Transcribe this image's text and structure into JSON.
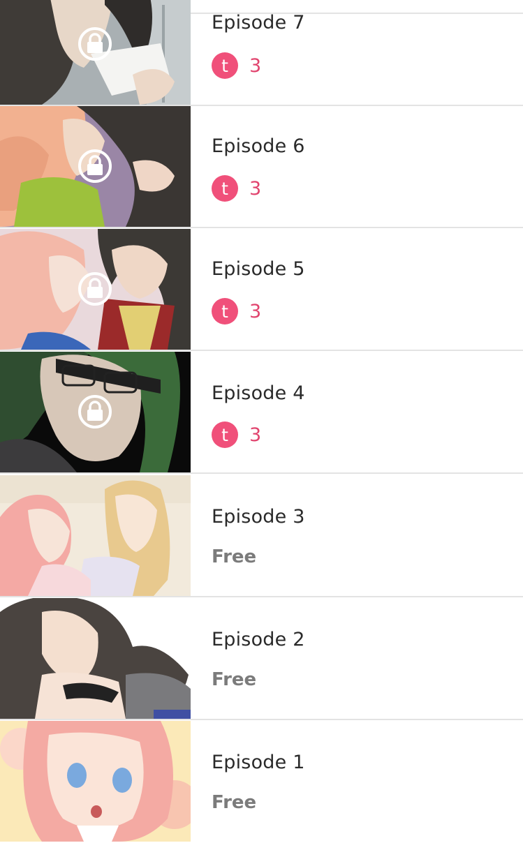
{
  "theme": {
    "coin_color": "#f0507a",
    "price_color": "#e1446e",
    "free_color": "#7b7b7b",
    "divider": "#e3e3e3"
  },
  "episodes": [
    {
      "title": "Episode 7",
      "locked": true,
      "coin_icon": "t",
      "cost": "3"
    },
    {
      "title": "Episode 6",
      "locked": true,
      "coin_icon": "t",
      "cost": "3"
    },
    {
      "title": "Episode 5",
      "locked": true,
      "coin_icon": "t",
      "cost": "3"
    },
    {
      "title": "Episode 4",
      "locked": true,
      "coin_icon": "t",
      "cost": "3"
    },
    {
      "title": "Episode 3",
      "locked": false,
      "price_label": "Free"
    },
    {
      "title": "Episode 2",
      "locked": false,
      "price_label": "Free"
    },
    {
      "title": "Episode 1",
      "locked": false,
      "price_label": "Free"
    }
  ],
  "icons": {
    "lock": "lock-icon",
    "coin": "coin-icon"
  }
}
